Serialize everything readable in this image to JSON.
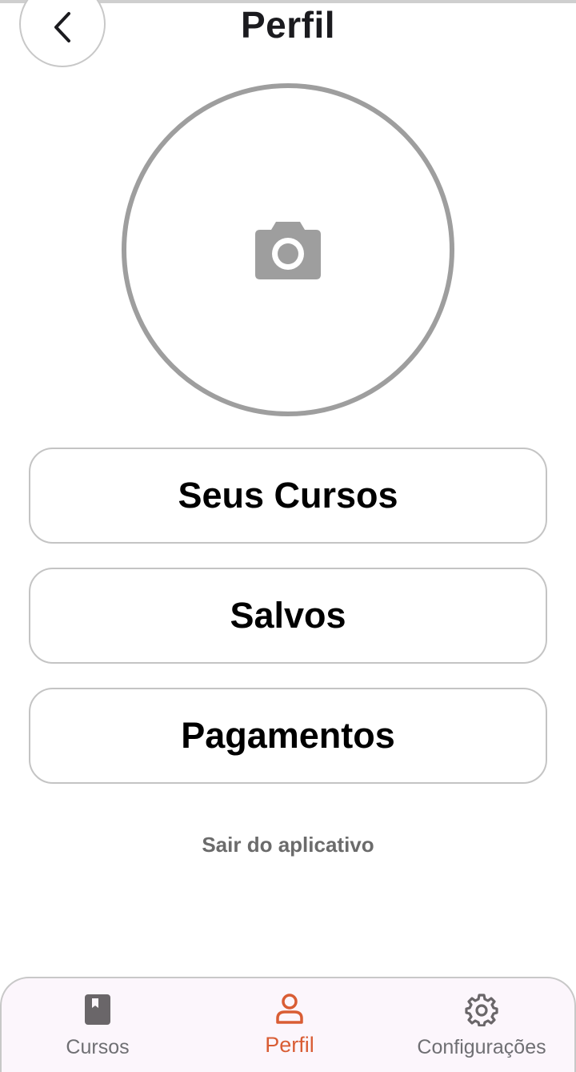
{
  "header": {
    "title": "Perfil",
    "back_icon": "chevron-left-icon"
  },
  "avatar": {
    "icon": "camera-icon",
    "border_color": "#9e9e9e"
  },
  "menu": {
    "items": [
      {
        "label": "Seus Cursos"
      },
      {
        "label": "Salvos"
      },
      {
        "label": "Pagamentos"
      }
    ]
  },
  "logout": {
    "label": "Sair do aplicativo"
  },
  "bottom_nav": {
    "active_color": "#d95d34",
    "items": [
      {
        "label": "Cursos",
        "icon": "book-icon",
        "active": false
      },
      {
        "label": "Perfil",
        "icon": "person-icon",
        "active": true
      },
      {
        "label": "Configurações",
        "icon": "gear-icon",
        "active": false
      }
    ]
  }
}
